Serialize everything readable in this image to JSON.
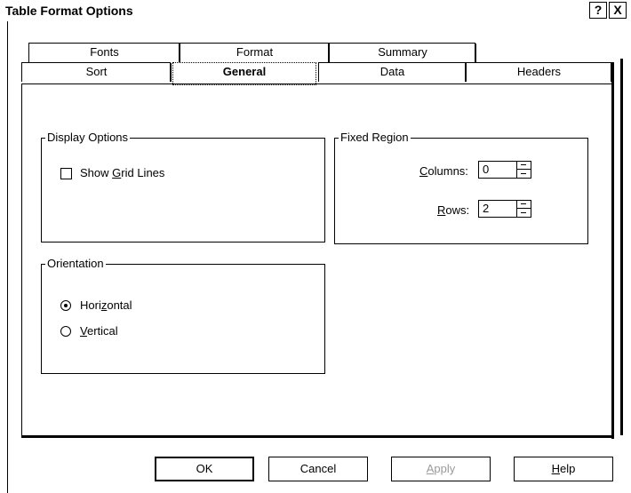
{
  "window": {
    "title": "Table Format Options",
    "help_glyph": "?",
    "close_glyph": "X"
  },
  "tabs_back": [
    {
      "label": "Fonts"
    },
    {
      "label": "Format"
    },
    {
      "label": "Summary"
    }
  ],
  "tabs_front": [
    {
      "label": "Sort"
    },
    {
      "label": "General"
    },
    {
      "label": "Data"
    },
    {
      "label": "Headers"
    }
  ],
  "selected_tab": "General",
  "display_options": {
    "legend": "Display Options",
    "show_grid_lines": {
      "pre": "Show ",
      "ul": "G",
      "post": "rid Lines",
      "checked": false
    }
  },
  "fixed_region": {
    "legend": "Fixed Region",
    "columns": {
      "ul": "C",
      "post": "olumns:",
      "value": "0"
    },
    "rows": {
      "ul": "R",
      "post": "ows:",
      "value": "2"
    }
  },
  "orientation": {
    "legend": "Orientation",
    "horizontal": {
      "pre": "Hori",
      "ul": "z",
      "post": "ontal",
      "selected": true
    },
    "vertical": {
      "ul": "V",
      "post": "ertical",
      "selected": false
    }
  },
  "buttons": {
    "ok": "OK",
    "cancel": "Cancel",
    "apply": {
      "ul": "A",
      "post": "pply",
      "disabled": true
    },
    "help": {
      "ul": "H",
      "post": "elp"
    }
  }
}
